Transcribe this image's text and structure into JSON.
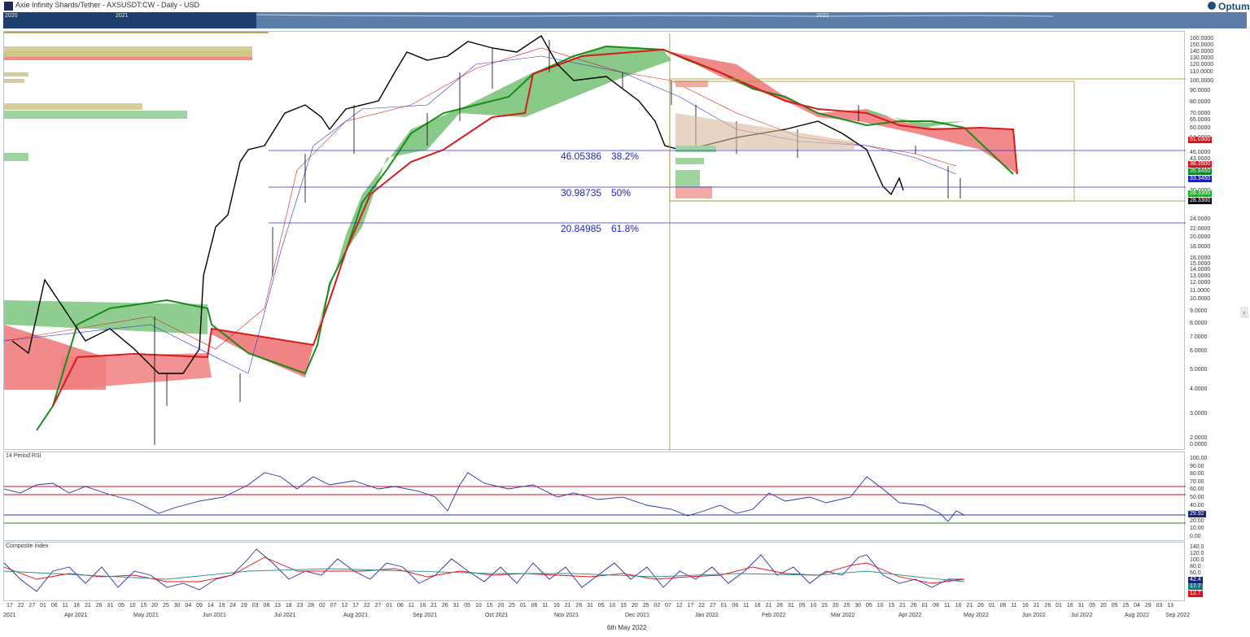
{
  "header": {
    "title": "Axie Infinity Shards/Tether - AXSUSDT:CW - Daily - USD",
    "brand": "Optuma"
  },
  "navigator": {
    "years": [
      "2020",
      "2021",
      "2022"
    ]
  },
  "price_axis": {
    "labels": [
      "160.0000",
      "150.0000",
      "140.0000",
      "130.0000",
      "120.0000",
      "110.0000",
      "100.0000",
      "90.0000",
      "80.0000",
      "70.0000",
      "65.0000",
      "60.0000",
      "54.0000",
      "46.0000",
      "43.0000",
      "38.0000",
      "30.0000",
      "24.0000",
      "22.0000",
      "20.0000",
      "18.0000",
      "16.0000",
      "15.0000",
      "14.0000",
      "13.0000",
      "12.0000",
      "11.0000",
      "10.0000",
      "9.0000",
      "8.0000",
      "7.0000",
      "6.0000",
      "5.0000",
      "4.0000",
      "3.0000",
      "2.0000",
      "0.0000"
    ],
    "tags": [
      {
        "text": "51.0300",
        "color": "#e0121b"
      },
      {
        "text": "38.3500",
        "color": "#e0121b"
      },
      {
        "text": "35.8450",
        "color": "#0e8a1e"
      },
      {
        "text": "33.3450",
        "color": "#1a1ae0"
      },
      {
        "text": "28.3300",
        "color": "#10c018"
      },
      {
        "text": "28.3300",
        "color": "#111111"
      }
    ]
  },
  "fib_levels": [
    {
      "price": "46.05386",
      "pct": "38.2%"
    },
    {
      "price": "30.98735",
      "pct": "50%"
    },
    {
      "price": "20.84985",
      "pct": "61.8%"
    }
  ],
  "rsi_panel": {
    "title": "14 Period RSI",
    "labels": [
      "100.00",
      "90.00",
      "80.00",
      "70.00",
      "60.00",
      "50.00",
      "40.00",
      "30.00",
      "20.00",
      "10.00",
      "0.00"
    ],
    "tag": {
      "text": "29.92",
      "color": "#1a237e"
    }
  },
  "composite_panel": {
    "title": "Composite Index",
    "labels": [
      "140.0",
      "120.0",
      "100.0",
      "80.0",
      "60.0",
      "40.0",
      "20.0"
    ],
    "tags": [
      {
        "text": "42.4",
        "color": "#1a237e"
      },
      {
        "text": "17.7",
        "color": "#1f7a7a"
      },
      {
        "text": "12.7",
        "color": "#e0121b"
      }
    ]
  },
  "x_axis": {
    "days": [
      "17",
      "22",
      "27",
      "01",
      "06",
      "11",
      "16",
      "21",
      "26",
      "31",
      "05",
      "10",
      "15",
      "20",
      "25",
      "30",
      "04",
      "09",
      "14",
      "19",
      "24",
      "29",
      "03",
      "08",
      "13",
      "18",
      "23",
      "28",
      "02",
      "07",
      "12",
      "17",
      "22",
      "27",
      "01",
      "06",
      "11",
      "16",
      "21",
      "26",
      "31",
      "05",
      "10",
      "15",
      "20",
      "25",
      "01",
      "06",
      "11",
      "16",
      "21",
      "26",
      "31",
      "05",
      "10",
      "15",
      "20",
      "25",
      "02",
      "07",
      "12",
      "17",
      "22",
      "27",
      "01",
      "06",
      "11",
      "16",
      "21",
      "26",
      "31",
      "05",
      "10",
      "15",
      "20",
      "25",
      "30",
      "05",
      "10",
      "15",
      "21",
      "26",
      "01",
      "06",
      "11",
      "16",
      "21",
      "26",
      "01",
      "06",
      "11",
      "16",
      "21",
      "26",
      "01",
      "16",
      "31",
      "05",
      "20",
      "05",
      "25",
      "04",
      "29",
      "03",
      "13"
    ],
    "months": [
      "2021",
      "Apr 2021",
      "May 2021",
      "Jun 2021",
      "Jul 2021",
      "Aug 2021",
      "Sep 2021",
      "Oct 2021",
      "Nov 2021",
      "Dec 2021",
      "Jan 2022",
      "Feb 2022",
      "Mar 2022",
      "Apr 2022",
      "May 2022",
      "Jun 2022",
      "Jul 2022",
      "Aug 2022",
      "Sep 2022"
    ]
  },
  "footer": {
    "date": "6th May 2022"
  },
  "colors": {
    "price_line": "#000000",
    "cloud_bull": "#7cc47c",
    "cloud_bear": "#f07e7e",
    "span_a": "#1b8a1b",
    "span_b": "#d81b1b",
    "fib_line": "#2b2fcf",
    "rsi_line": "#2b2fa6",
    "overbought": "#c8102e"
  }
}
